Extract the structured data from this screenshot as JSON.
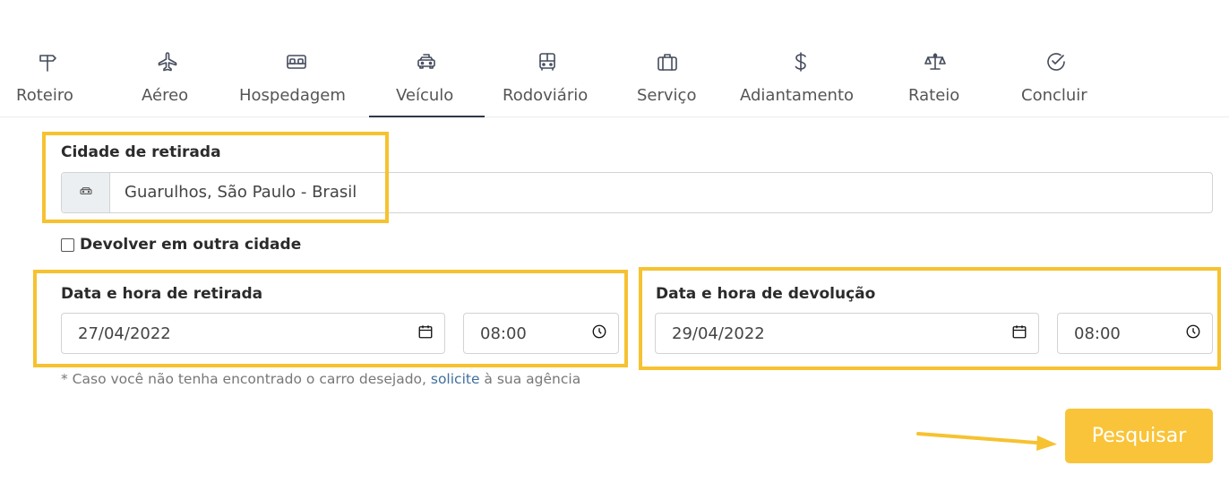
{
  "tabs": [
    {
      "label": "Roteiro",
      "icon": "signpost-icon"
    },
    {
      "label": "Aéreo",
      "icon": "plane-icon"
    },
    {
      "label": "Hospedagem",
      "icon": "bed-icon"
    },
    {
      "label": "Veículo",
      "icon": "car-icon",
      "active": true
    },
    {
      "label": "Rodoviário",
      "icon": "bus-icon"
    },
    {
      "label": "Serviço",
      "icon": "suitcase-icon"
    },
    {
      "label": "Adiantamento",
      "icon": "dollar-icon"
    },
    {
      "label": "Rateio",
      "icon": "scale-icon"
    },
    {
      "label": "Concluir",
      "icon": "check-circle-icon"
    }
  ],
  "pickup_city": {
    "label": "Cidade de retirada",
    "value": "Guarulhos, São Paulo - Brasil",
    "icon": "car-icon"
  },
  "return_other_city": {
    "label": "Devolver em outra cidade",
    "checked": false
  },
  "pickup_datetime": {
    "label": "Data e hora de retirada",
    "date": "27/04/2022",
    "time": "08:00"
  },
  "return_datetime": {
    "label": "Data e hora de devolução",
    "date": "29/04/2022",
    "time": "08:00"
  },
  "note": {
    "prefix": "* Caso você não tenha encontrado o carro desejado, ",
    "link": "solicite",
    "suffix": " à sua agência"
  },
  "search_button": "Pesquisar",
  "colors": {
    "highlight": "#f6c230",
    "button": "#f9c43a",
    "link": "#3f6f9e"
  }
}
